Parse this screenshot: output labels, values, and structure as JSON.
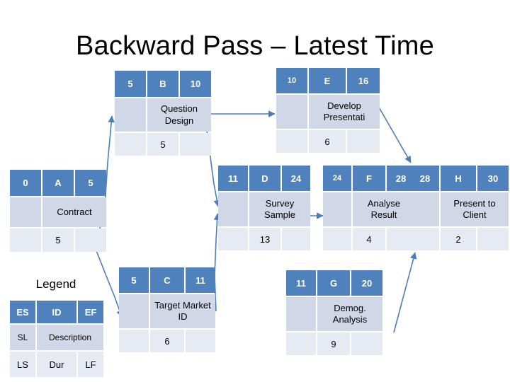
{
  "slide": {
    "title": "Backward Pass – Latest Time",
    "background": "#ffffff",
    "accent_color": "#4F81BD",
    "node_mid_color": "#D0D8E8",
    "node_bot_color": "#E6EAF3",
    "connector_color": "#4A7EBB"
  },
  "legend": {
    "title": "Legend",
    "es": "ES",
    "id": "ID",
    "ef": "EF",
    "sl": "SL",
    "description": "Description",
    "ls": "LS",
    "dur": "Dur",
    "lf": "LF"
  },
  "nodes": [
    {
      "key": "B",
      "es": "5",
      "id": "B",
      "ef": "10",
      "sl": "",
      "description": "Question Design",
      "ls": "",
      "dur": "5",
      "lf": ""
    },
    {
      "key": "E",
      "es": "10",
      "id": "E",
      "ef": "16",
      "sl": "",
      "description": "Develop Presentati",
      "ls": "",
      "dur": "6",
      "lf": ""
    },
    {
      "key": "A",
      "es": "0",
      "id": "A",
      "ef": "5",
      "sl": "",
      "description": "Contract",
      "ls": "",
      "dur": "5",
      "lf": ""
    },
    {
      "key": "D",
      "es": "11",
      "id": "D",
      "ef": "24",
      "sl": "",
      "description": "Survey Sample",
      "ls": "",
      "dur": "13",
      "lf": ""
    },
    {
      "key": "F",
      "es": "24",
      "id": "F",
      "ef": "28",
      "sl": "",
      "description": "Analyse Result",
      "ls": "",
      "dur": "4",
      "lf": ""
    },
    {
      "key": "H",
      "es": "28",
      "id": "H",
      "ef": "30",
      "sl": "",
      "description": "Present to Client",
      "ls": "",
      "dur": "2",
      "lf": ""
    },
    {
      "key": "C",
      "es": "5",
      "id": "C",
      "ef": "11",
      "sl": "",
      "description": "Target Market ID",
      "ls": "",
      "dur": "6",
      "lf": ""
    },
    {
      "key": "G",
      "es": "11",
      "id": "G",
      "ef": "20",
      "sl": "",
      "description": "Demog. Analysis",
      "ls": "",
      "dur": "9",
      "lf": ""
    }
  ]
}
